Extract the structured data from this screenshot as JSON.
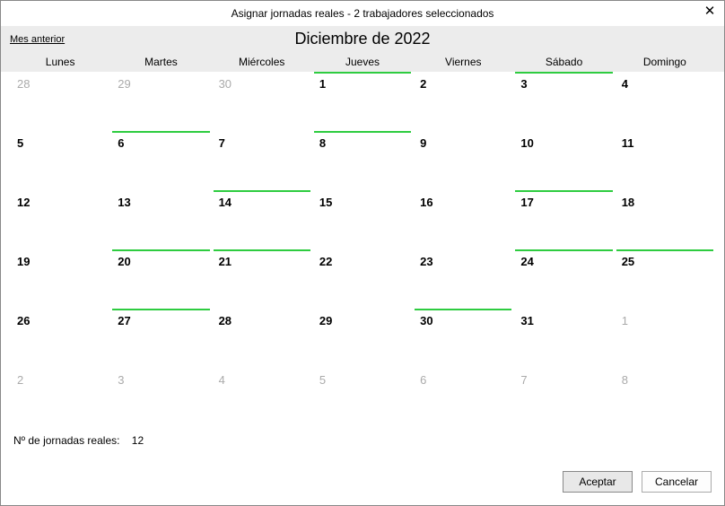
{
  "title": "Asignar jornadas reales - 2 trabajadores seleccionados",
  "nav": {
    "prev_month": "Mes anterior"
  },
  "month_title": "Diciembre de 2022",
  "day_headers": [
    "Lunes",
    "Martes",
    "Miércoles",
    "Jueves",
    "Viernes",
    "Sábado",
    "Domingo"
  ],
  "cells": [
    {
      "d": "28",
      "other": true,
      "marked": false
    },
    {
      "d": "29",
      "other": true,
      "marked": false
    },
    {
      "d": "30",
      "other": true,
      "marked": false
    },
    {
      "d": "1",
      "other": false,
      "marked": true
    },
    {
      "d": "2",
      "other": false,
      "marked": false
    },
    {
      "d": "3",
      "other": false,
      "marked": true
    },
    {
      "d": "4",
      "other": false,
      "marked": false
    },
    {
      "d": "5",
      "other": false,
      "marked": false
    },
    {
      "d": "6",
      "other": false,
      "marked": true
    },
    {
      "d": "7",
      "other": false,
      "marked": false
    },
    {
      "d": "8",
      "other": false,
      "marked": true
    },
    {
      "d": "9",
      "other": false,
      "marked": false
    },
    {
      "d": "10",
      "other": false,
      "marked": false
    },
    {
      "d": "11",
      "other": false,
      "marked": false
    },
    {
      "d": "12",
      "other": false,
      "marked": false
    },
    {
      "d": "13",
      "other": false,
      "marked": false
    },
    {
      "d": "14",
      "other": false,
      "marked": true
    },
    {
      "d": "15",
      "other": false,
      "marked": false
    },
    {
      "d": "16",
      "other": false,
      "marked": false
    },
    {
      "d": "17",
      "other": false,
      "marked": true
    },
    {
      "d": "18",
      "other": false,
      "marked": false
    },
    {
      "d": "19",
      "other": false,
      "marked": false
    },
    {
      "d": "20",
      "other": false,
      "marked": true
    },
    {
      "d": "21",
      "other": false,
      "marked": true
    },
    {
      "d": "22",
      "other": false,
      "marked": false
    },
    {
      "d": "23",
      "other": false,
      "marked": false
    },
    {
      "d": "24",
      "other": false,
      "marked": true
    },
    {
      "d": "25",
      "other": false,
      "marked": true
    },
    {
      "d": "26",
      "other": false,
      "marked": false
    },
    {
      "d": "27",
      "other": false,
      "marked": true
    },
    {
      "d": "28",
      "other": false,
      "marked": false
    },
    {
      "d": "29",
      "other": false,
      "marked": false
    },
    {
      "d": "30",
      "other": false,
      "marked": true
    },
    {
      "d": "31",
      "other": false,
      "marked": false
    },
    {
      "d": "1",
      "other": true,
      "marked": false
    },
    {
      "d": "2",
      "other": true,
      "marked": false
    },
    {
      "d": "3",
      "other": true,
      "marked": false
    },
    {
      "d": "4",
      "other": true,
      "marked": false
    },
    {
      "d": "5",
      "other": true,
      "marked": false
    },
    {
      "d": "6",
      "other": true,
      "marked": false
    },
    {
      "d": "7",
      "other": true,
      "marked": false
    },
    {
      "d": "8",
      "other": true,
      "marked": false
    }
  ],
  "footer": {
    "label": "Nº de jornadas reales:",
    "value": "12"
  },
  "actions": {
    "ok": "Aceptar",
    "cancel": "Cancelar"
  }
}
